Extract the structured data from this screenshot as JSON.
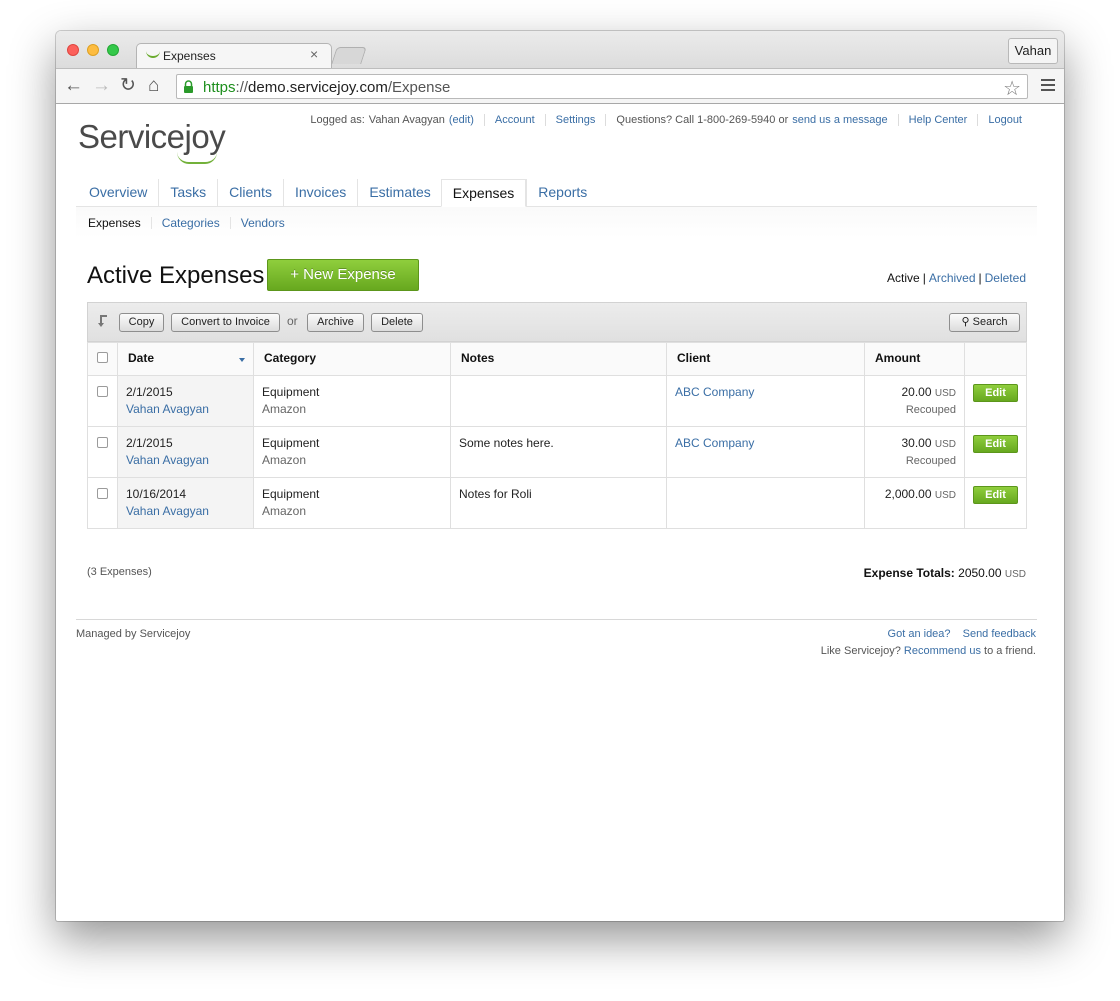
{
  "browser": {
    "tab_title": "Expenses",
    "tab_close": "×",
    "profile_name": "Vahan",
    "url_scheme": "https",
    "url_sep": "://",
    "url_host": "demo.servicejoy.com",
    "url_path": "/Expense",
    "icons": [
      "back-arrow-icon",
      "forward-arrow-icon",
      "reload-icon",
      "home-icon",
      "lock-icon",
      "star-icon",
      "menu-icon"
    ],
    "colors": {
      "secure": "#1d8f1d"
    }
  },
  "header": {
    "logo_text": "Servicejoy",
    "logged_as_label": "Logged as:",
    "user_name": "Vahan Avagyan",
    "edit_label": "(edit)",
    "account": "Account",
    "settings": "Settings",
    "questions_text": "Questions? Call 1-800-269-5940 or",
    "send_message": "send us a message",
    "help_center": "Help Center",
    "logout": "Logout"
  },
  "nav": {
    "tabs": [
      {
        "label": "Overview"
      },
      {
        "label": "Tasks"
      },
      {
        "label": "Clients"
      },
      {
        "label": "Invoices"
      },
      {
        "label": "Estimates"
      },
      {
        "label": "Expenses",
        "active": true
      },
      {
        "label": "Reports"
      }
    ],
    "subtabs": [
      {
        "label": "Expenses",
        "active": true
      },
      {
        "label": "Categories"
      },
      {
        "label": "Vendors"
      }
    ]
  },
  "main": {
    "title": "Active Expenses",
    "new_button": "+ New Expense",
    "filter": {
      "active": "Active",
      "archived": "Archived",
      "deleted": "Deleted",
      "sep": "|"
    },
    "actions": {
      "copy": "Copy",
      "convert": "Convert to Invoice",
      "or": "or",
      "archive": "Archive",
      "delete": "Delete",
      "search": "Search"
    },
    "columns": [
      "Date",
      "Category",
      "Notes",
      "Client",
      "Amount"
    ],
    "rows": [
      {
        "date": "2/1/2015",
        "user": "Vahan Avagyan",
        "category": "Equipment",
        "vendor": "Amazon",
        "notes": "",
        "client": "ABC Company",
        "amount": "20.00",
        "currency": "USD",
        "status": "Recouped",
        "edit": "Edit"
      },
      {
        "date": "2/1/2015",
        "user": "Vahan Avagyan",
        "category": "Equipment",
        "vendor": "Amazon",
        "notes": "Some notes here.",
        "client": "ABC Company",
        "amount": "30.00",
        "currency": "USD",
        "status": "Recouped",
        "edit": "Edit"
      },
      {
        "date": "10/16/2014",
        "user": "Vahan Avagyan",
        "category": "Equipment",
        "vendor": "Amazon",
        "notes": "Notes for Roli",
        "client": "",
        "amount": "2,000.00",
        "currency": "USD",
        "status": "",
        "edit": "Edit"
      }
    ],
    "count_text": "(3 Expenses)",
    "totals_label": "Expense Totals:",
    "totals_value": "2050.00",
    "totals_currency": "USD",
    "colors": {
      "primary_button": "#78bb2c",
      "link": "#3a6ea5"
    }
  },
  "footer": {
    "managed_by": "Managed by Servicejoy",
    "got_idea": "Got an idea?",
    "send_feedback": "Send feedback",
    "like_text": "Like Servicejoy?",
    "recommend": "Recommend us",
    "to_friend": "to a friend."
  }
}
